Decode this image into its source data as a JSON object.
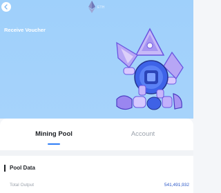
{
  "header": {
    "network_label": "ETH",
    "title": "Receive Voucher"
  },
  "tabs": [
    {
      "label": "Mining Pool",
      "active": true
    },
    {
      "label": "Account",
      "active": false
    }
  ],
  "pool": {
    "section_title": "Pool Data",
    "rows": [
      {
        "label": "Total Output",
        "value": "541,491,932"
      }
    ]
  },
  "colors": {
    "hero_background": "#a3d2fb",
    "accent": "#2d7df6",
    "value_text": "#2a57c7"
  },
  "icons": {
    "back": "chevron-left-icon",
    "network": "ethereum-icon",
    "illustration": "robot-mascot-illustration"
  }
}
